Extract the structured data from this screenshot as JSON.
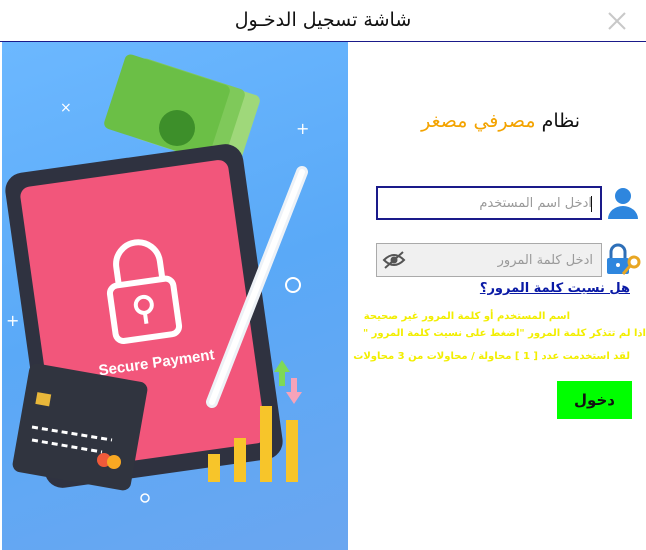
{
  "window": {
    "title": "شاشة تسجيل الدخـول"
  },
  "brand": {
    "system": "نظام",
    "name": "مصرفي مصغر"
  },
  "username": {
    "placeholder": "ادخل اسم المستخدم",
    "value": ""
  },
  "password": {
    "placeholder": "ادخل كلمة المرور",
    "value": ""
  },
  "forgot_link": "هل نسيت كلمة المرور؟",
  "messages": [
    "اسم المستخدم أو كلمة المرور غير صحيحة",
    "اذا لم تتذكر كلمة المرور \"اضغط على نسيت كلمة المرور \"",
    "لقد استخدمت عدد [ 1 ] محاولة / محاولات من 3 محاولات"
  ],
  "login_button": "دخول",
  "illustration": {
    "caption": "Secure Payment"
  },
  "colors": {
    "accent": "#f3a300",
    "button": "#00ff00",
    "message": "#f2ee00",
    "link": "#0a1aa5",
    "frame": "#1a1a8a"
  },
  "icons": {
    "close": "close-icon",
    "user": "user-icon",
    "lock": "lock-key-icon",
    "eye": "eye-slash-icon"
  }
}
